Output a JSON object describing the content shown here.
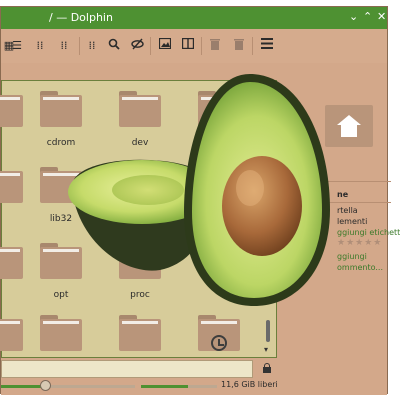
{
  "window": {
    "title": "/ — Dolphin",
    "controls": {
      "minimize": "⌄",
      "maximize": "⌃",
      "close": "✕"
    },
    "title_bar_color": "#4e9132",
    "background_color": "#d3a88a"
  },
  "toolbar": {
    "buttons": [
      {
        "icon": "icons-view-icon"
      },
      {
        "icon": "details-view-icon"
      },
      {
        "icon": "compact-view-icon"
      },
      {
        "icon": "split-view-icon"
      },
      {
        "icon": "search-icon"
      },
      {
        "icon": "hidden-files-icon"
      },
      {
        "icon": "preview-icon"
      },
      {
        "icon": "split-pane-icon"
      },
      {
        "icon": "trash-icon"
      },
      {
        "icon": "delete-icon"
      },
      {
        "icon": "hamburger-menu-icon"
      }
    ]
  },
  "folders": [
    {
      "label": "cdrom"
    },
    {
      "label": "dev"
    },
    {
      "label": "lib32"
    },
    {
      "label": "opt"
    },
    {
      "label": "proc"
    }
  ],
  "info_panel": {
    "heading": "ne",
    "rows": [
      "rtella",
      "lementi"
    ],
    "link_tags": "ggiungi etichette",
    "rating_stars": "★★★★★",
    "link_comment_1": "ggiungi",
    "link_comment_2": "ommento..."
  },
  "statusbar": {
    "free_space": "11,6 GiB liberi",
    "zoom_level": 0.33,
    "disk_used_fraction": 0.62
  },
  "overlay": {
    "image": "avocado-halves-photo"
  }
}
